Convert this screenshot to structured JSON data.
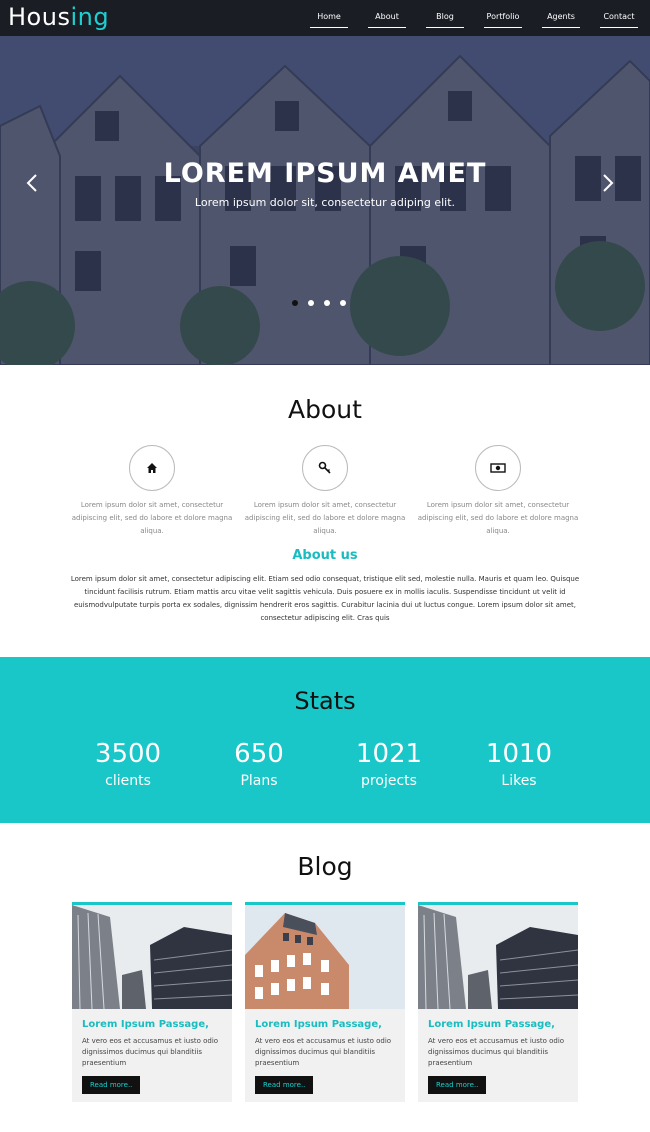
{
  "brand": {
    "prefix": "Hous",
    "accent": "ing",
    "accent_color": "#1fcfd0"
  },
  "nav": [
    "Home",
    "About",
    "Blog",
    "Portfolio",
    "Agents",
    "Contact"
  ],
  "hero": {
    "title": "LOREM IPSUM AMET",
    "subtitle": "Lorem ipsum dolor sit, consectetur adiping elit.",
    "prev_icon": "chevron-left-icon",
    "next_icon": "chevron-right-icon",
    "slides": 4,
    "active_slide": 1
  },
  "about": {
    "title": "About",
    "features": [
      {
        "icon": "home-icon",
        "text": "Lorem ipsum dolor sit amet, consectetur adipiscing elit, sed do labore et dolore magna aliqua."
      },
      {
        "icon": "key-icon",
        "text": "Lorem ipsum dolor sit amet, consectetur adipiscing elit, sed do labore et dolore magna aliqua."
      },
      {
        "icon": "money-icon",
        "text": "Lorem ipsum dolor sit amet, consectetur adipiscing elit, sed do labore et dolore magna aliqua."
      }
    ],
    "about_us_title": "About us",
    "about_us_text": "Lorem ipsum dolor sit amet, consectetur adipiscing elit. Etiam sed odio consequat, tristique elit sed, molestie nulla. Mauris et quam leo. Quisque tincidunt facilisis rutrum. Etiam mattis arcu vitae velit sagittis vehicula. Duis posuere ex in mollis iaculis. Suspendisse tincidunt ut velit id euismodvulputate turpis porta ex sodales, dignissim hendrerit eros sagittis. Curabitur lacinia dui ut luctus congue. Lorem ipsum dolor sit amet, consectetur adipiscing elit. Cras quis"
  },
  "stats": {
    "title": "Stats",
    "bg_color": "#19c7c8",
    "items": [
      {
        "value": "3500",
        "label": "clients"
      },
      {
        "value": "650",
        "label": "Plans"
      },
      {
        "value": "1021",
        "label": "projects"
      },
      {
        "value": "1010",
        "label": "Likes"
      }
    ]
  },
  "blog": {
    "title": "Blog",
    "posts": [
      {
        "image": "glass-skyscrapers-photo",
        "title": "Lorem Ipsum Passage,",
        "text": "At vero eos et accusamus et iusto odio dignissimos ducimus qui blanditiis praesentium",
        "button": "Read more.."
      },
      {
        "image": "brick-building-photo",
        "title": "Lorem Ipsum Passage,",
        "text": "At vero eos et accusamus et iusto odio dignissimos ducimus qui blanditiis praesentium",
        "button": "Read more.."
      },
      {
        "image": "glass-skyscrapers-photo",
        "title": "Lorem Ipsum Passage,",
        "text": "At vero eos et accusamus et iusto odio dignissimos ducimus qui blanditiis praesentium",
        "button": "Read more.."
      }
    ]
  }
}
